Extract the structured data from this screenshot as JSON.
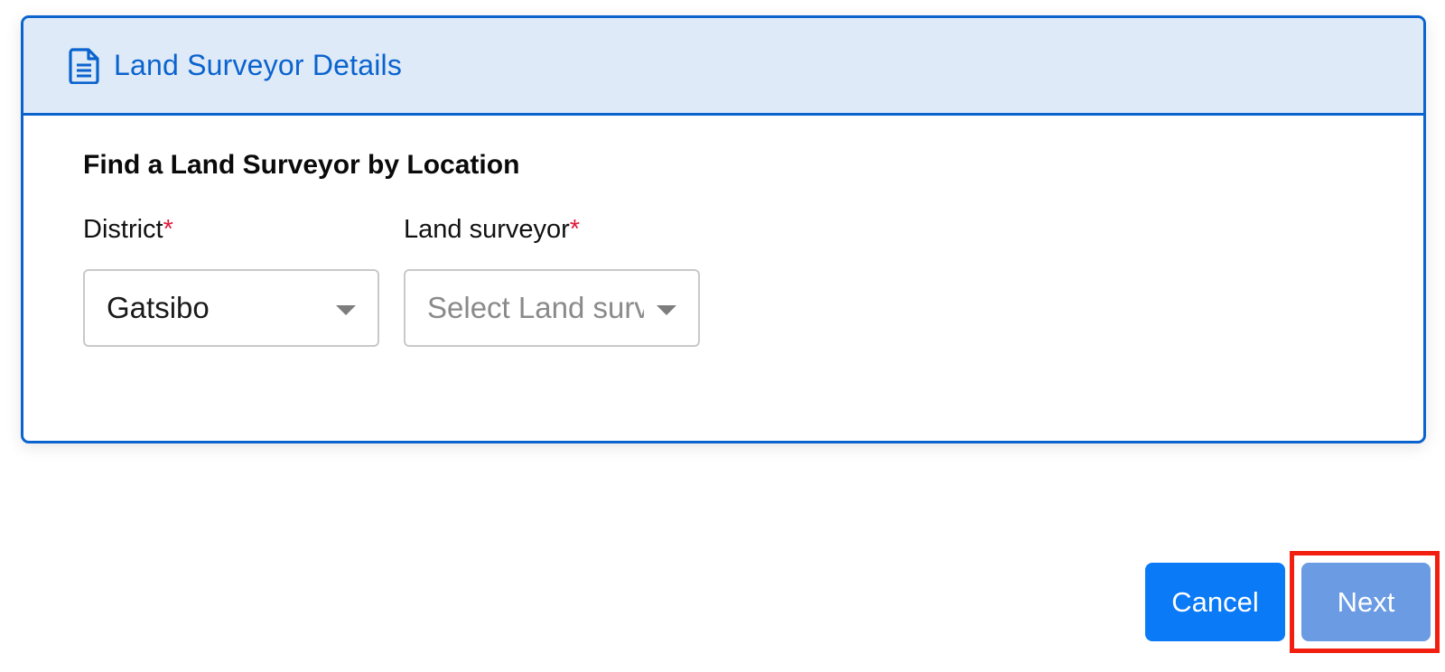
{
  "card": {
    "title": "Land Surveyor Details",
    "header_icon": "document-icon"
  },
  "form": {
    "heading": "Find a Land Surveyor by Location",
    "district": {
      "label": "District",
      "required_mark": "*",
      "value": "Gatsibo"
    },
    "surveyor": {
      "label": "Land surveyor",
      "required_mark": "*",
      "placeholder": "Select Land surveyor"
    }
  },
  "actions": {
    "cancel_label": "Cancel",
    "next_label": "Next"
  },
  "colors": {
    "accent": "#0b63ce",
    "header_bg": "#deeaf7",
    "required": "#e0193c",
    "cancel_bg": "#0b7af7",
    "next_bg_disabled": "#6a9be3",
    "highlight": "#f21f10"
  }
}
